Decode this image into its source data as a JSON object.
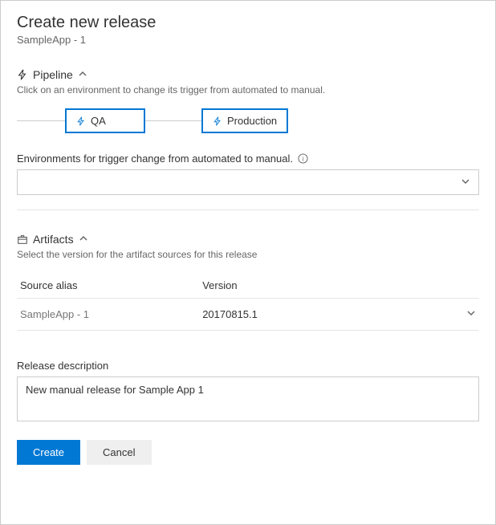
{
  "title": "Create new release",
  "subtitle": "SampleApp - 1",
  "pipeline": {
    "section_title": "Pipeline",
    "section_desc": "Click on an environment to change its trigger from automated to manual.",
    "environments": [
      {
        "label": "QA"
      },
      {
        "label": "Production"
      }
    ],
    "trigger_label": "Environments for trigger change from automated to manual.",
    "dropdown_value": ""
  },
  "artifacts": {
    "section_title": "Artifacts",
    "section_desc": "Select the version for the artifact sources for this release",
    "columns": {
      "alias": "Source alias",
      "version": "Version"
    },
    "rows": [
      {
        "alias": "SampleApp - 1",
        "version": "20170815.1"
      }
    ]
  },
  "release_description": {
    "label": "Release description",
    "value": "New manual release for Sample App 1"
  },
  "buttons": {
    "create": "Create",
    "cancel": "Cancel"
  }
}
